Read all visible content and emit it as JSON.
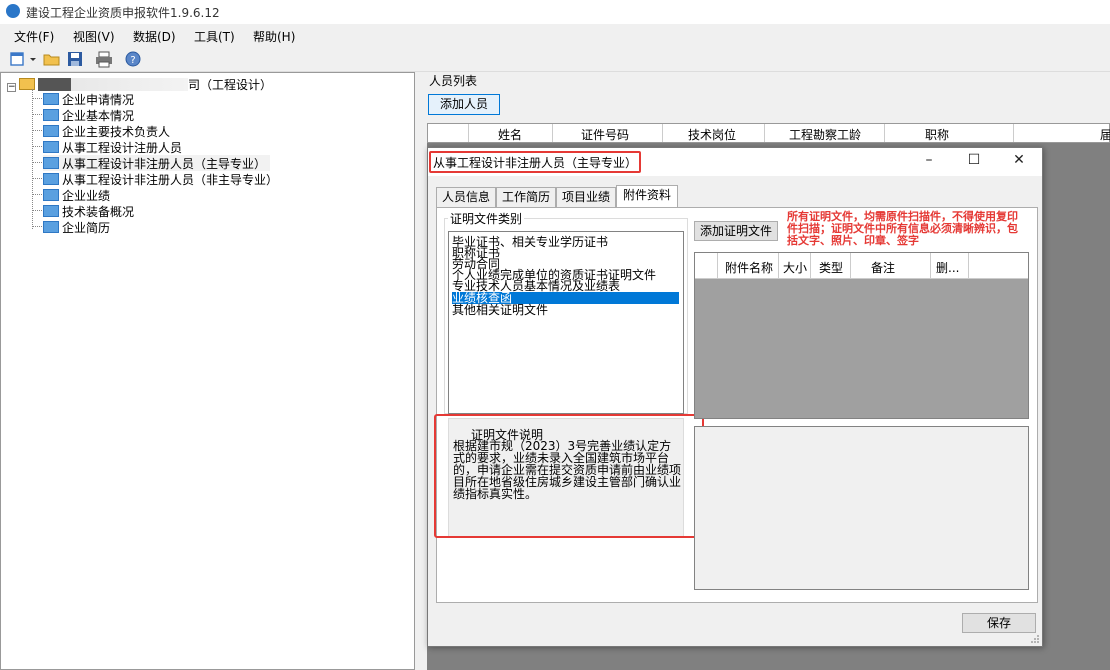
{
  "window": {
    "title": "建设工程企业资质申报软件1.9.6.12"
  },
  "menu": {
    "items": [
      "文件(F)",
      "视图(V)",
      "数据(D)",
      "工具(T)",
      "帮助(H)"
    ]
  },
  "toolbar": {
    "icons": [
      "new-icon",
      "open-folder-icon",
      "save-icon",
      "print-icon",
      "help-icon"
    ]
  },
  "tree": {
    "root_label": "司（工程设计）",
    "items": [
      "企业申请情况",
      "企业基本情况",
      "企业主要技术负责人",
      "从事工程设计注册人员",
      "从事工程设计非注册人员（主导专业）",
      "从事工程设计非注册人员（非主导专业）",
      "企业业绩",
      "技术装备概况",
      "企业简历"
    ]
  },
  "main": {
    "list_label": "人员列表",
    "add_button": "添加人员",
    "columns": [
      "姓名",
      "证件号码",
      "技术岗位",
      "工程勘察工龄",
      "职称",
      "届"
    ]
  },
  "dialog": {
    "title": "从事工程设计非注册人员（主导专业）",
    "tabs": [
      "人员信息",
      "工作简历",
      "项目业绩",
      "附件资料"
    ],
    "active_tab": "附件资料",
    "category_legend": "证明文件类别",
    "categories": [
      "毕业证书、相关专业学历证书",
      "职称证书",
      "劳动合同",
      "个人业绩完成单位的资质证书证明文件",
      "专业技术人员基本情况及业绩表",
      "业绩核查函",
      "其他相关证明文件"
    ],
    "selected_category": "业绩核查函",
    "add_cert_button": "添加证明文件",
    "warning": "所有证明文件，均需原件扫描件，不得使用复印件扫描；证明文件中所有信息必须清晰辨识，包括文字、照片、印章、签字",
    "attachment_columns": [
      "附件名称",
      "大小",
      "类型",
      "备注",
      "删..."
    ],
    "description_legend": "证明文件说明",
    "description": "根据建市规（2023）3号完善业绩认定方式的要求，业绩未录入全国建筑市场平台的，申请企业需在提交资质申请前由业绩项目所在地省级住房城乡建设主管部门确认业绩指标真实性。",
    "save_button": "保存"
  },
  "colors": {
    "highlight_outline": "#e53935",
    "selection": "#0078d7",
    "warning_text": "#e53935"
  }
}
